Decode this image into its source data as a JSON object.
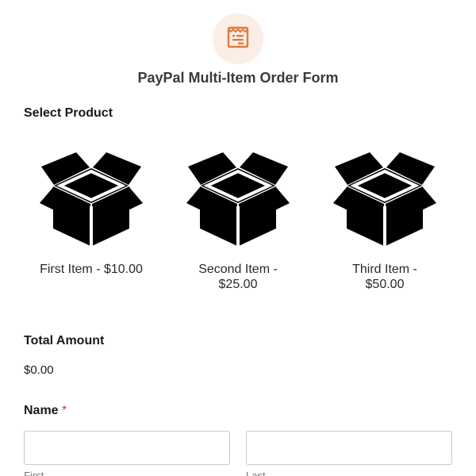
{
  "form": {
    "title": "PayPal Multi-Item Order Form",
    "icon": "order-form-icon",
    "accent_color": "#e07b39"
  },
  "select_product": {
    "label": "Select Product",
    "items": [
      {
        "label": "First Item - $10.00",
        "icon": "open-box-icon"
      },
      {
        "label": "Second Item - $25.00",
        "icon": "open-box-icon"
      },
      {
        "label": "Third Item - $50.00",
        "icon": "open-box-icon"
      }
    ]
  },
  "total": {
    "label": "Total Amount",
    "value": "$0.00"
  },
  "name_field": {
    "label": "Name",
    "required_mark": "*",
    "first": {
      "value": "",
      "sublabel": "First"
    },
    "last": {
      "value": "",
      "sublabel": "Last"
    }
  }
}
